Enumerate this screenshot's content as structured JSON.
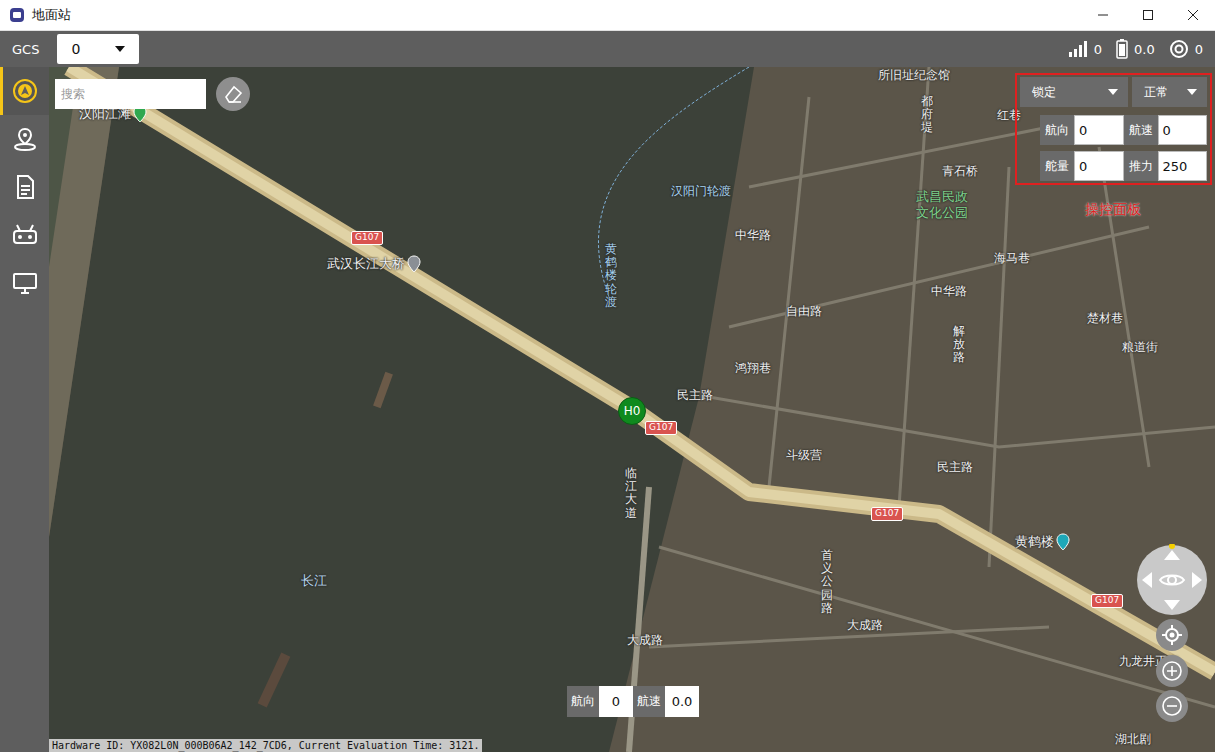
{
  "window": {
    "title": "地面站"
  },
  "toolbar": {
    "label": "GCS",
    "vehicle": "0",
    "status": [
      {
        "kind": "signal",
        "value": "0"
      },
      {
        "kind": "battery",
        "value": "0.0"
      },
      {
        "kind": "gps",
        "value": "0"
      }
    ]
  },
  "sidebar": {
    "items": [
      {
        "selected": true
      },
      {
        "selected": false
      },
      {
        "selected": false
      },
      {
        "selected": false
      },
      {
        "selected": false
      }
    ]
  },
  "search": {
    "placeholder": "搜索"
  },
  "control_panel": {
    "mode": "锁定",
    "state": "正常",
    "fields": [
      {
        "label": "航向",
        "value": "0"
      },
      {
        "label": "航速",
        "value": "0"
      },
      {
        "label": "舵量",
        "value": "0"
      },
      {
        "label": "推力",
        "value": "250"
      }
    ],
    "annotation": "操控面板"
  },
  "readout": [
    {
      "label": "航向",
      "value": "0"
    },
    {
      "label": "航速",
      "value": "0.0"
    }
  ],
  "map": {
    "home": "H0",
    "shields": [
      "G107",
      "G107",
      "G107",
      "G107"
    ],
    "labels": [
      {
        "text": "汉阳江滩",
        "kind": "poi"
      },
      {
        "text": "所旧址纪念馆",
        "kind": "street"
      },
      {
        "text": "都府堤",
        "kind": "street-v"
      },
      {
        "text": "红巷",
        "kind": "street"
      },
      {
        "text": "青石桥",
        "kind": "street"
      },
      {
        "text": "武昌民政文化公园",
        "kind": "park"
      },
      {
        "text": "海马巷",
        "kind": "street"
      },
      {
        "text": "中华路",
        "kind": "street"
      },
      {
        "text": "中华路",
        "kind": "street"
      },
      {
        "text": "自由路",
        "kind": "street"
      },
      {
        "text": "鸿翔巷",
        "kind": "street"
      },
      {
        "text": "民主路",
        "kind": "street"
      },
      {
        "text": "斗级营",
        "kind": "street"
      },
      {
        "text": "民主路",
        "kind": "street"
      },
      {
        "text": "临江大道",
        "kind": "street-v"
      },
      {
        "text": "武汉长江大桥",
        "kind": "poi"
      },
      {
        "text": "汉阳门轮渡",
        "kind": "ferry"
      },
      {
        "text": "黄鹤楼轮渡",
        "kind": "ferry-v"
      },
      {
        "text": "楚材巷",
        "kind": "street"
      },
      {
        "text": "粮道街",
        "kind": "street"
      },
      {
        "text": "黄鹤楼",
        "kind": "poi"
      },
      {
        "text": "长江",
        "kind": "water"
      },
      {
        "text": "大成路",
        "kind": "street"
      },
      {
        "text": "大成路",
        "kind": "street"
      },
      {
        "text": "首义公园路",
        "kind": "street-v"
      },
      {
        "text": "九龙井正街",
        "kind": "street"
      },
      {
        "text": "湖北剧",
        "kind": "street"
      },
      {
        "text": "解放路",
        "kind": "street-v"
      }
    ]
  },
  "watermark": "Hardware ID: YX082L0N_000B06A2_142_7CD6, Current Evaluation Time: 3121."
}
